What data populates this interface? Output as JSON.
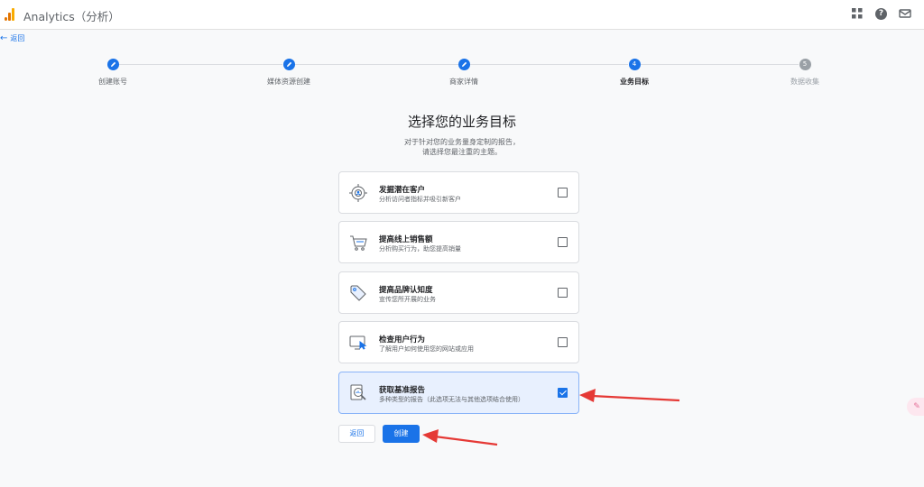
{
  "header": {
    "app_title": "Analytics（分析）",
    "icons": [
      "analytics-logo",
      "apps-grid-icon",
      "help-icon",
      "feedback-icon"
    ]
  },
  "back_link": {
    "arrow": "←",
    "label": "返回"
  },
  "stepper": {
    "steps": [
      {
        "label": "创建账号",
        "state": "done",
        "number": ""
      },
      {
        "label": "媒体资源创建",
        "state": "done",
        "number": ""
      },
      {
        "label": "商家详情",
        "state": "done",
        "number": ""
      },
      {
        "label": "业务目标",
        "state": "active",
        "number": "4"
      },
      {
        "label": "数据收集",
        "state": "todo",
        "number": "5"
      }
    ]
  },
  "main": {
    "title": "选择您的业务目标",
    "subtitle_line1": "对于针对您的业务量身定制的报告，",
    "subtitle_line2": "请选择您最注重的主题。",
    "options": [
      {
        "title": "发掘潜在客户",
        "description": "分析访问者指标并吸引新客户",
        "checked": false,
        "icon": "target-person-icon"
      },
      {
        "title": "提高线上销售额",
        "description": "分析购买行为，助您提高销量",
        "checked": false,
        "icon": "shopping-cart-icon"
      },
      {
        "title": "提高品牌认知度",
        "description": "宣传您所开展的业务",
        "checked": false,
        "icon": "tag-icon"
      },
      {
        "title": "检查用户行为",
        "description": "了解用户如何使用您的网站或应用",
        "checked": false,
        "icon": "screen-cursor-icon"
      },
      {
        "title": "获取基准报告",
        "description": "多种类型的报告（此选项无法与其他选项结合使用）",
        "checked": true,
        "icon": "magnifier-report-icon"
      }
    ]
  },
  "buttons": {
    "back_label": "返回",
    "create_label": "创建"
  },
  "colors": {
    "primary": "#1a73e8",
    "selected_bg": "#e8f0fe",
    "annotation_red": "#e53935"
  }
}
